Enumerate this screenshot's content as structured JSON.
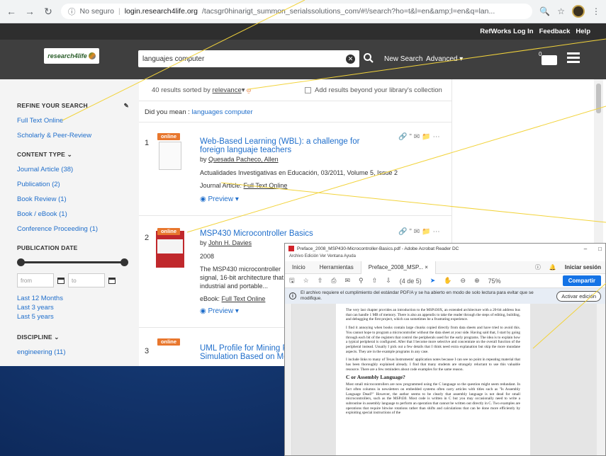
{
  "browser": {
    "security": "No seguro",
    "url_host": "login.research4life.org",
    "url_path": "/tacsgr0hinarigt_summon_serialssolutions_com/#!/search?ho=t&l=en&amp;l=en&q=lan..."
  },
  "topbar": {
    "refworks": "RefWorks Log In",
    "feedback": "Feedback",
    "help": "Help"
  },
  "header": {
    "logo_text": "research4life",
    "search_value": "languajes computer",
    "new_search": "New Search",
    "advanced": "Advanced",
    "folder_count": "0"
  },
  "sidebar": {
    "refine_heading": "REFINE YOUR SEARCH",
    "full_text": "Full Text Online",
    "scholarly": "Scholarly & Peer-Review",
    "content_type_heading": "CONTENT TYPE",
    "content_types": [
      "Journal Article (38)",
      "Publication (2)",
      "Book Review (1)",
      "Book / eBook (1)",
      "Conference Proceeding (1)"
    ],
    "pub_date_heading": "PUBLICATION DATE",
    "from_placeholder": "from",
    "to_placeholder": "to",
    "date_links": [
      "Last 12 Months",
      "Last 3 years",
      "Last 5 years"
    ],
    "discipline_heading": "DISCIPLINE",
    "discipline_first": "engineering (11)"
  },
  "results": {
    "summary_prefix": "40 results sorted by",
    "sort": "relevance",
    "beyond": "Add results beyond your library's collection",
    "did_you_mean_prefix": "Did you mean :",
    "did_you_mean": "languages computer",
    "items": [
      {
        "num": "1",
        "badge": "online",
        "title": "Web-Based Learning (WBL): a challenge for foreign languaje teachers",
        "by": "by",
        "author": "Quesada Pacheco, Allen",
        "source": "Actualidades Investigativas en Educación, 03/2011, Volume 5, Issue 2",
        "type_label": "Journal Article:",
        "fulltext": "Full Text Online",
        "preview": "Preview"
      },
      {
        "num": "2",
        "badge": "online",
        "title": "MSP430 Microcontroller Basics",
        "by": "by",
        "author": "John H. Davies",
        "year": "2008",
        "snippet1": "The MSP430 microcontroller",
        "snippet2": "signal, 16-bit architecture that",
        "snippet3": "industrial and portable...",
        "type_label": "eBook:",
        "fulltext": "Full Text Online",
        "preview": "Preview"
      },
      {
        "num": "3",
        "badge": "online",
        "title1": "UML Profile for Mining Pro",
        "title2": "Simulation Based on Meta"
      }
    ]
  },
  "acrobat": {
    "title": "Preface_2008_MSP430-Microcontroller-Basics.pdf - Adobe Acrobat Reader DC",
    "menu": "Archivo   Edición   Ver   Ventana   Ayuda",
    "tab_home": "Inicio",
    "tab_tools": "Herramientas",
    "tab_doc": "Preface_2008_MSP...",
    "signin": "Iniciar sesión",
    "page_of": "(4 de 5)",
    "zoom": "75%",
    "share": "Compartir",
    "info": "El archivo requiere el cumplimiento del estándar PDF/A y se ha abierto en modo de solo lectura para evitar que se modifique.",
    "enable_edit": "Activar edición",
    "para1": "The very last chapter provides an introduction to the MSP430X, an extended architecture with a 20-bit address bus that can handle 1 MB of memory. There is also an appendix to take the reader through the steps of editing, building, and debugging the first project, which can sometimes be a frustrating experience.",
    "para2": "I find it annoying when books contain large chunks copied directly from data sheets and have tried to avoid this. You cannot hope to program a microcontroller without the data sheet at your side. Having said that, I start by going through each bit of the registers that control the peripherals used for the early programs. The idea is to explain how a typical peripheral is configured. After that I become more selective and concentrate on the overall function of the peripheral instead. Usually I pick out a few details that I think need extra explanation but skip the more mundane aspects. They are in the example programs in any case.",
    "para3": "I include links to many of Texas Instruments' application notes because I can see no point in repeating material that has been thoroughly explained already. I find that many students are strangely reluctant to use this valuable resource. There are a few reminders about code examples for the same reason.",
    "heading": "C or Assembly Language?",
    "para4": "Most small microcontrollers are now programmed using the C language so the question might seem redundant. In fact often columns in newsletters on embedded systems often carry articles with titles such as \"Is Assembly Language Dead?\" However, the author seems to be clearly that assembly language is not dead for small microcontrollers, such as the MSP430. Most code is written in C but you may occasionally need to write a subroutine in assembly language to perform an operation that cannot be written out directly in C. Two examples are operations that require bitwise rotations rather than shifts and calculations that can be done more efficiently by exploiting special instructions of the"
  }
}
